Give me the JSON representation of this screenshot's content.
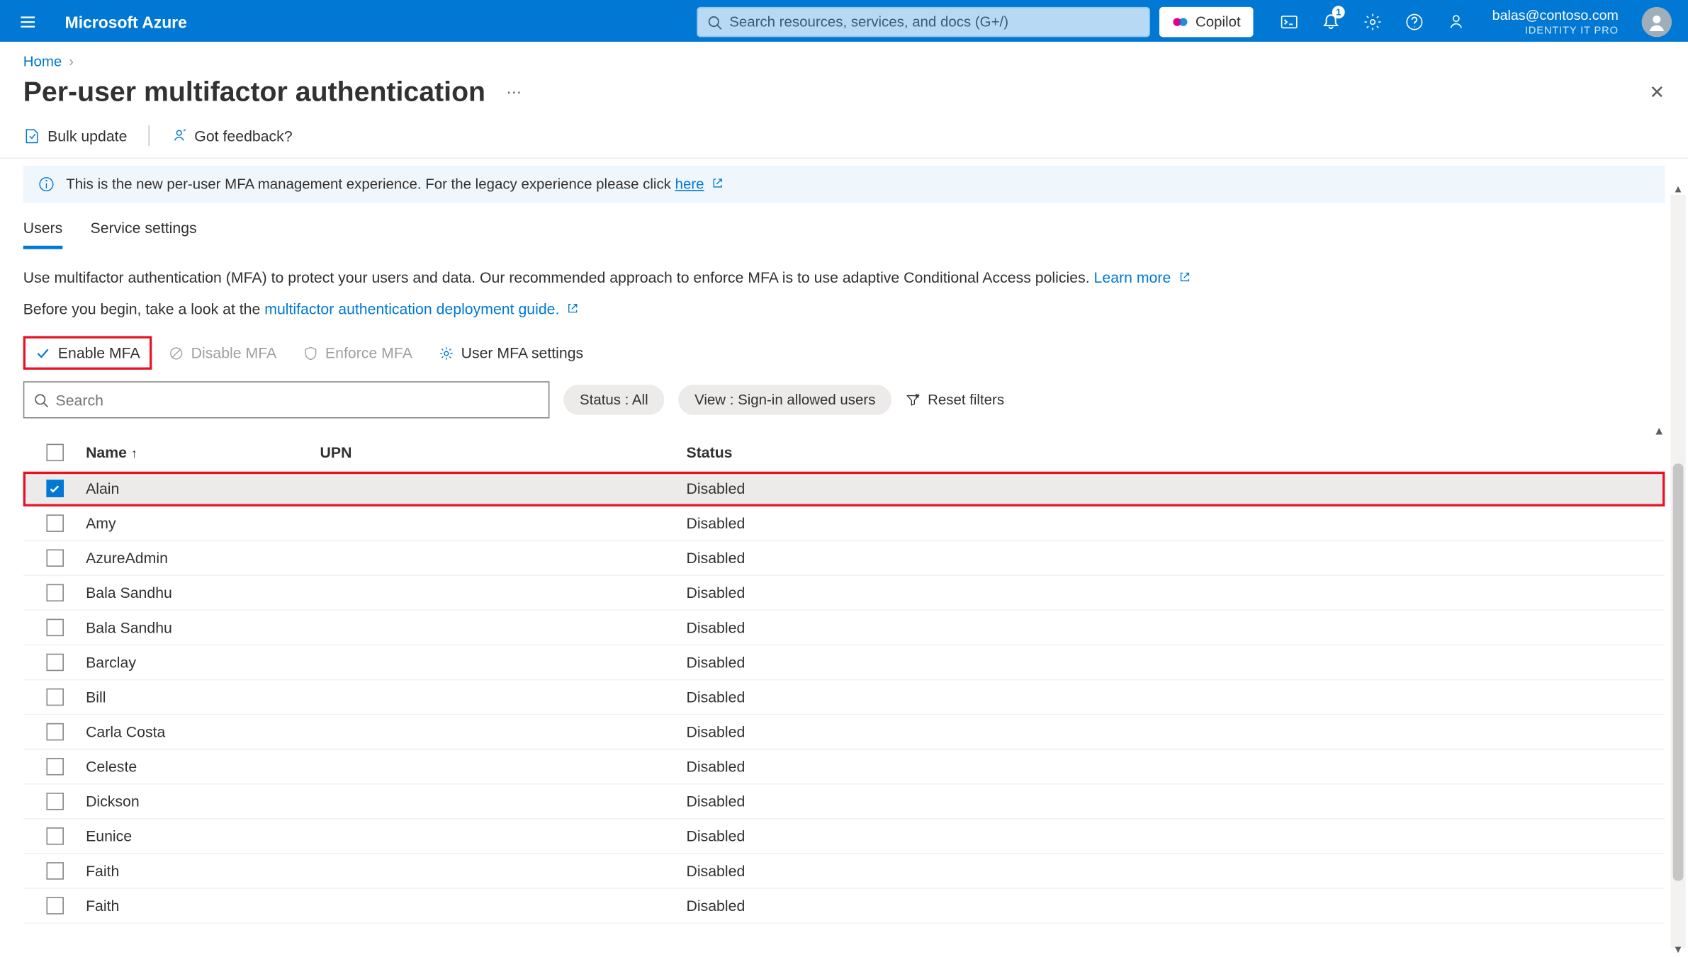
{
  "header": {
    "brand": "Microsoft Azure",
    "search_placeholder": "Search resources, services, and docs (G+/)",
    "copilot_label": "Copilot",
    "notification_badge": "1",
    "user_email": "balas@contoso.com",
    "user_tenant": "IDENTITY IT PRO"
  },
  "breadcrumb": {
    "home": "Home"
  },
  "page": {
    "title": "Per-user multifactor authentication",
    "more": "⋯"
  },
  "toolbar": {
    "bulk_update": "Bulk update",
    "feedback": "Got feedback?"
  },
  "banner": {
    "text_prefix": "This is the new per-user MFA management experience. For the legacy experience please click ",
    "link": "here"
  },
  "tabs": {
    "users": "Users",
    "service_settings": "Service settings"
  },
  "intro": {
    "line1_prefix": "Use multifactor authentication (MFA) to protect your users and data. Our recommended approach to enforce MFA is to use adaptive Conditional Access policies. ",
    "learn_more": "Learn more",
    "line2_prefix": "Before you begin, take a look at the ",
    "line2_link": "multifactor authentication deployment guide."
  },
  "actions": {
    "enable": "Enable MFA",
    "disable": "Disable MFA",
    "enforce": "Enforce MFA",
    "settings": "User MFA settings"
  },
  "filters": {
    "search_placeholder": "Search",
    "status_pill": "Status : All",
    "view_pill": "View : Sign-in allowed users",
    "reset": "Reset filters"
  },
  "table": {
    "headers": {
      "name": "Name",
      "upn": "UPN",
      "status": "Status"
    },
    "rows": [
      {
        "name": "Alain",
        "upn": "",
        "status": "Disabled",
        "checked": true,
        "selected": true,
        "highlight": true
      },
      {
        "name": "Amy",
        "upn": "",
        "status": "Disabled",
        "checked": false,
        "selected": false
      },
      {
        "name": "AzureAdmin",
        "upn": "",
        "status": "Disabled",
        "checked": false,
        "selected": false
      },
      {
        "name": "Bala Sandhu",
        "upn": "",
        "status": "Disabled",
        "checked": false,
        "selected": false
      },
      {
        "name": "Bala Sandhu",
        "upn": "",
        "status": "Disabled",
        "checked": false,
        "selected": false
      },
      {
        "name": "Barclay",
        "upn": "",
        "status": "Disabled",
        "checked": false,
        "selected": false
      },
      {
        "name": "Bill",
        "upn": "",
        "status": "Disabled",
        "checked": false,
        "selected": false
      },
      {
        "name": "Carla Costa",
        "upn": "",
        "status": "Disabled",
        "checked": false,
        "selected": false
      },
      {
        "name": "Celeste",
        "upn": "",
        "status": "Disabled",
        "checked": false,
        "selected": false
      },
      {
        "name": "Dickson",
        "upn": "",
        "status": "Disabled",
        "checked": false,
        "selected": false
      },
      {
        "name": "Eunice",
        "upn": "",
        "status": "Disabled",
        "checked": false,
        "selected": false
      },
      {
        "name": "Faith",
        "upn": "",
        "status": "Disabled",
        "checked": false,
        "selected": false
      },
      {
        "name": "Faith",
        "upn": "",
        "status": "Disabled",
        "checked": false,
        "selected": false
      }
    ]
  }
}
